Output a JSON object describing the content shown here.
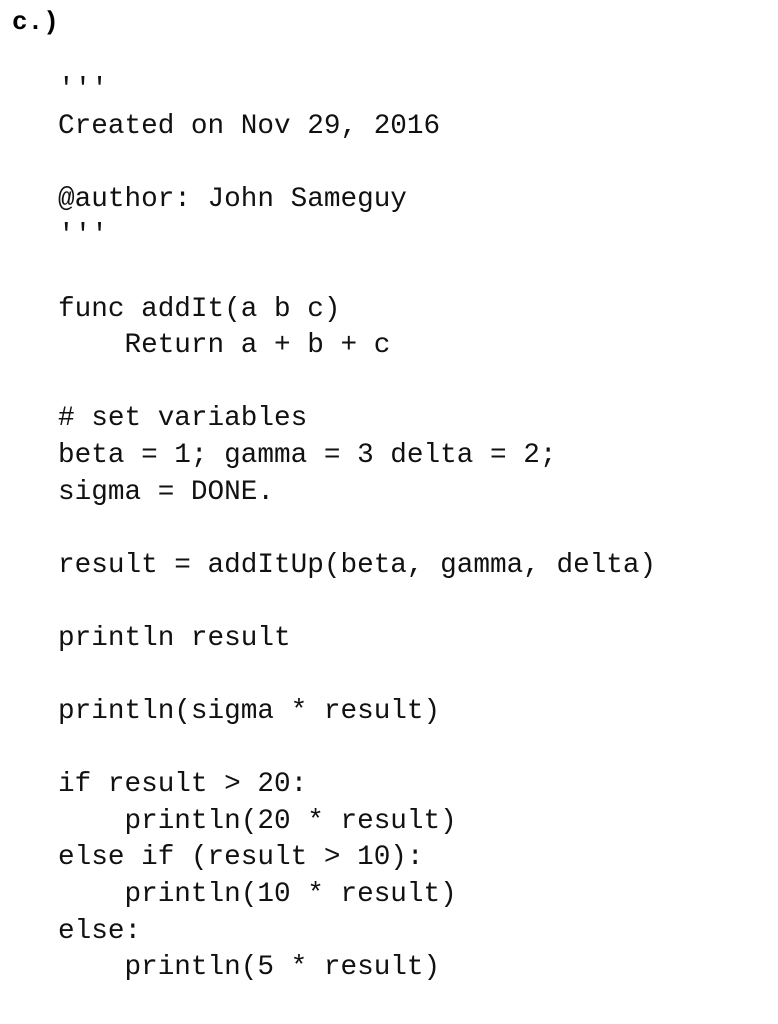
{
  "label": "c.)",
  "code_lines": [
    "'''",
    "Created on Nov 29, 2016",
    "",
    "@author: John Sameguy",
    "'''",
    "",
    "func addIt(a b c)",
    "    Return a + b + c",
    "",
    "# set variables",
    "beta = 1; gamma = 3 delta = 2;",
    "sigma = DONE.",
    "",
    "result = addItUp(beta, gamma, delta)",
    "",
    "println result",
    "",
    "println(sigma * result)",
    "",
    "if result > 20:",
    "    println(20 * result)",
    "else if (result > 10):",
    "    println(10 * result)",
    "else:",
    "    println(5 * result)"
  ]
}
